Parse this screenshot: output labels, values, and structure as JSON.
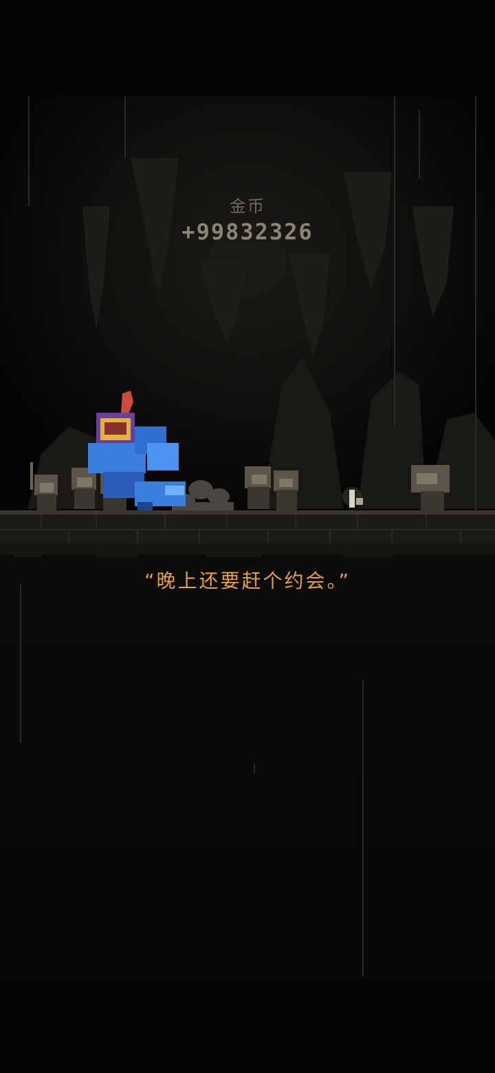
{
  "reward": {
    "title": "金币",
    "value": "+99832326"
  },
  "dialogue": {
    "text": "“晚上还要赶个约会。”"
  },
  "colors": {
    "background": "#050505",
    "dialogue_text": "#e8a23a",
    "reward_value": "#8b8474",
    "reward_title": "#6f6a5f",
    "hero_blue": "#3a7fe0",
    "hero_plume": "#d0493f"
  },
  "scene": {
    "setting": "dark-cave",
    "hero": "blue-knight-icon",
    "crowd": "villager-crowd-icon"
  }
}
